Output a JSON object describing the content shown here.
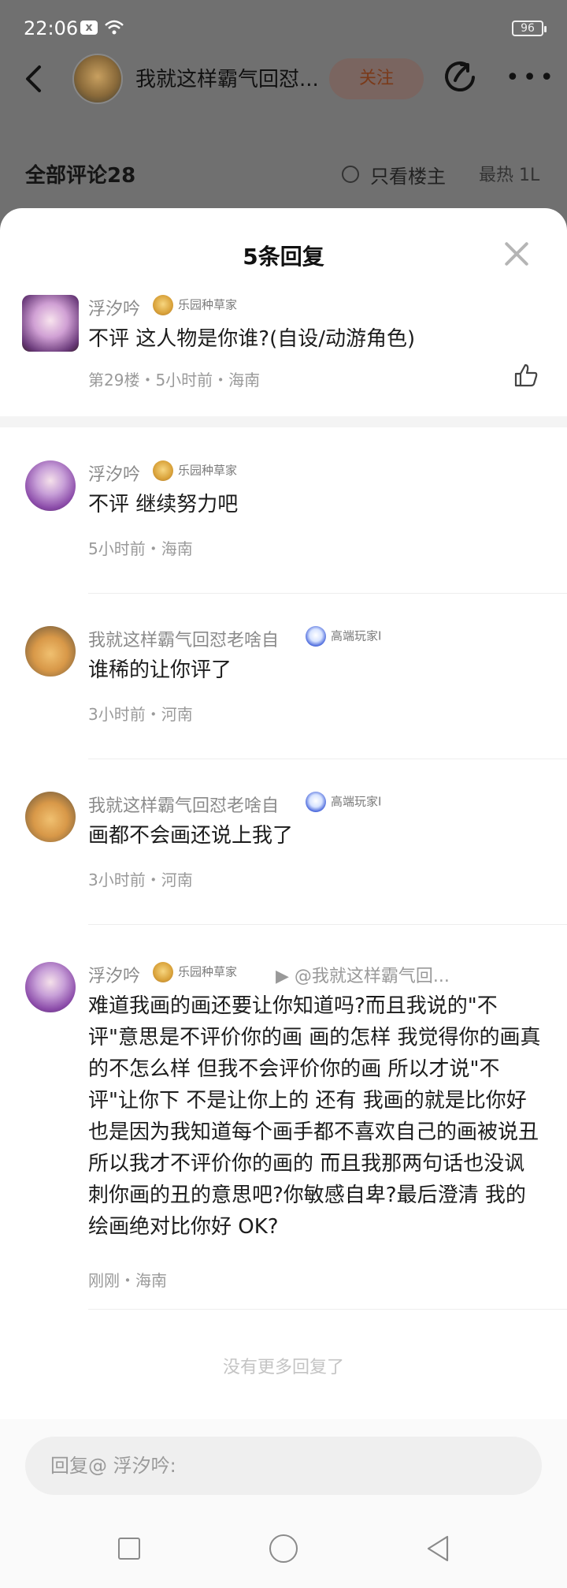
{
  "status_bar": {
    "time": "22:06",
    "notif_icon": "x",
    "battery": "96"
  },
  "header": {
    "title": "我就这样霸气回怼...",
    "follow_label": "关注"
  },
  "comments_header": {
    "all_label": "全部评论28",
    "only_op_label": "只看楼主",
    "sort_label": "最热 1L"
  },
  "sheet": {
    "title": "5条回复",
    "main": {
      "name": "浮汐吟",
      "badge": "乐园种草家",
      "text": "不评 这人物是你谁?(自设/动游角色)",
      "meta": "第29楼・5小时前・海南"
    },
    "replies": [
      {
        "name": "浮汐吟",
        "badge": "乐园种草家",
        "text": "不评 继续努力吧",
        "meta": "5小时前・海南"
      },
      {
        "name": "我就这样霸气回怼老啥自",
        "badge": "高端玩家I",
        "text": "谁稀的让你评了",
        "meta": "3小时前・河南"
      },
      {
        "name": "我就这样霸气回怼老啥自",
        "badge": "高端玩家I",
        "text": "画都不会画还说上我了",
        "meta": "3小时前・河南"
      },
      {
        "name": "浮汐吟",
        "badge": "乐园种草家",
        "reply_to": "▶ @我就这样霸气回...",
        "text": "难道我画的画还要让你知道吗?而且我说的\"不评\"意思是不评价你的画 画的怎样 我觉得你的画真的不怎么样 但我不会评价你的画 所以才说\"不评\"让你下 不是让你上的 还有 我画的就是比你好  也是因为我知道每个画手都不喜欢自己的画被说丑 所以我才不评价你的画的 而且我那两句话也没讽刺你画的丑的意思吧?你敏感自卑?最后澄清 我的绘画绝对比你好 OK?",
        "meta": "刚刚・海南"
      }
    ],
    "no_more": "没有更多回复了"
  },
  "input": {
    "placeholder": "回复@ 浮汐吟:"
  },
  "icons": [
    "back-icon",
    "share-icon",
    "more-icon",
    "close-icon",
    "like-icon",
    "wifi-icon",
    "battery-icon"
  ]
}
